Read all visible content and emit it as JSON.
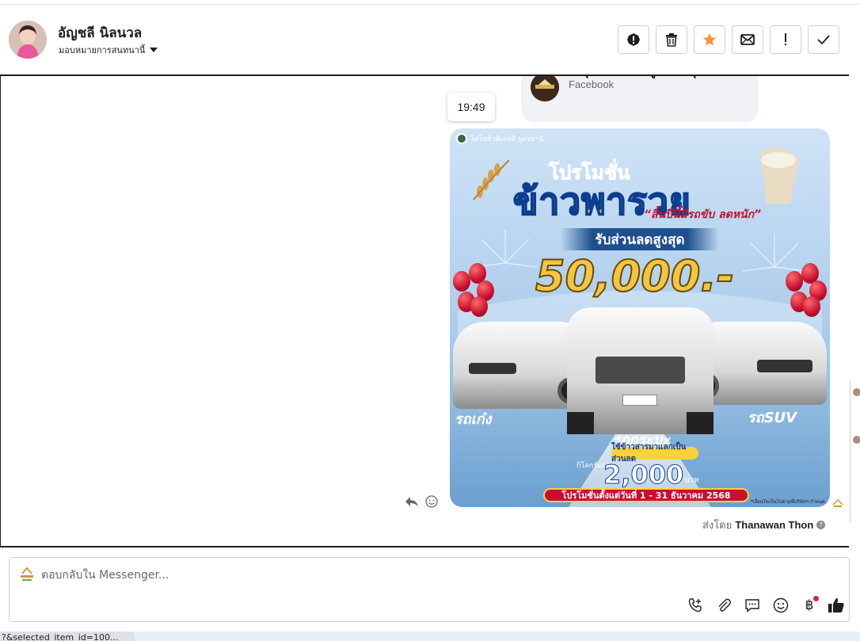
{
  "header": {
    "contact_name": "อัญชลี นิลนวล",
    "assign_label": "มอบหมายการสนทนานี้"
  },
  "toolbar": {
    "buttons": [
      {
        "icon": "exclamation-circle-icon"
      },
      {
        "icon": "trash-icon"
      },
      {
        "icon": "star-icon",
        "color": "#f7923a"
      },
      {
        "icon": "envelope-icon"
      },
      {
        "icon": "exclamation-icon"
      },
      {
        "icon": "check-icon"
      }
    ]
  },
  "thread": {
    "reply_quote": {
      "title": "วิทยุเมลลอ่ง โยคคูณโยค มุดร",
      "source": "Facebook"
    },
    "timestamp": "19:49",
    "promo_image": {
      "page_name": "โตโยต้าทีเอสดี ยุดรธานี",
      "title_line1": "โปรโมชั่น",
      "title_line2": "ข้าวพารวย",
      "subtitle": "“สิ้นปีนี้มีรถขับ ลดหนัก”",
      "band": "รับส่วนลดสูงสุด",
      "amount": "50,000.-",
      "label_left": "รถเก๋ง",
      "label_right": "รถSUV",
      "label_center": "รถกระบะ",
      "pill": "ใช้ข้าวสารมาแลกเป็นส่วนลด",
      "per": "กิโลกรัมละ",
      "price": "2,000",
      "unit": "บาท",
      "footer": "โปรโมชั่นตั้งแต่วันที่ 1 - 31 ธันวาคม 2568",
      "note": "*เงื่อนไขเป็นไปตามที่บริษัทฯ กำหนด"
    },
    "sent_by_prefix": "ส่งโดย",
    "sent_by_name": "Thanawan Thon"
  },
  "composer": {
    "placeholder": "ตอบกลับใน Messenger...",
    "icons": [
      "phone-plus-icon",
      "paperclip-icon",
      "chat-bubble-icon",
      "smiley-icon",
      "baht-icon",
      "thumbs-up-icon"
    ]
  },
  "statusbar": {
    "text": "?&selected_item_id=100..."
  },
  "colors": {
    "accent": "#f7923a",
    "like": "#1c1e21",
    "notification": "#e41e3f"
  }
}
